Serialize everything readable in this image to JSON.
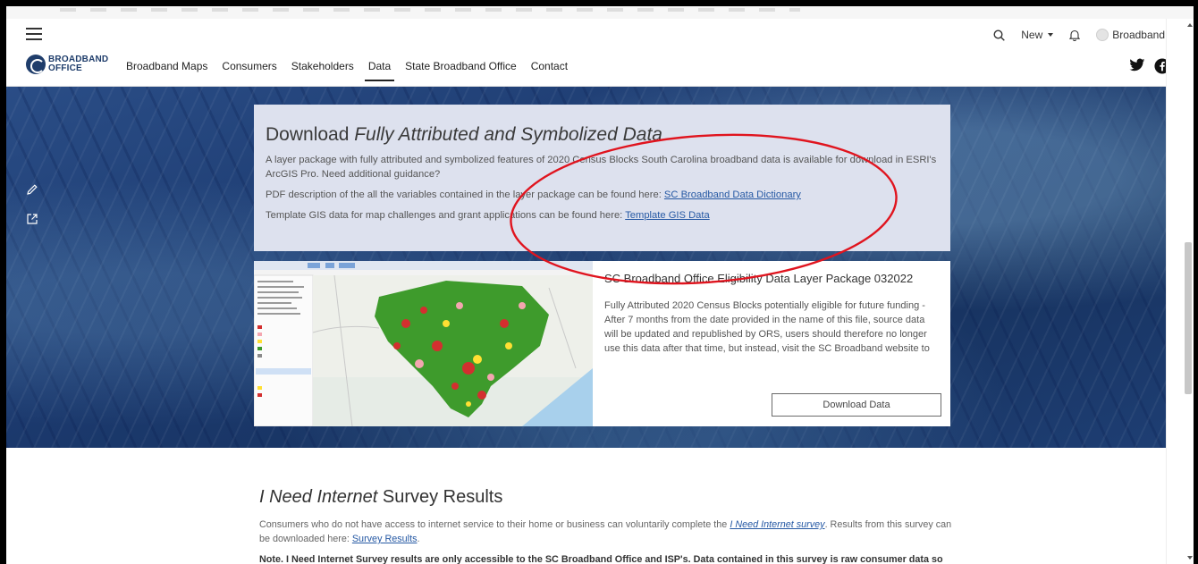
{
  "header": {
    "logo_line1": "BROADBAND",
    "logo_line2": "OFFICE",
    "nav": [
      {
        "label": "Broadband Maps"
      },
      {
        "label": "Consumers"
      },
      {
        "label": "Stakeholders"
      },
      {
        "label": "Data",
        "active": true
      },
      {
        "label": "State Broadband Office"
      },
      {
        "label": "Contact"
      }
    ],
    "util": {
      "new_label": "New",
      "account_label": "Broadband"
    },
    "icons": [
      "menu-icon",
      "search-icon",
      "bell-icon",
      "twitter-icon",
      "facebook-icon"
    ]
  },
  "side_tools": [
    "edit-icon",
    "share-icon"
  ],
  "info": {
    "title_plain": "Download ",
    "title_em": "Fully Attributed and Symbolized Data",
    "para1": "A layer package with fully attributed and symbolized features of 2020 Census Blocks South Carolina broadband data is available for download in ESRI's ArcGIS Pro. Need additional guidance?",
    "para2_text": "PDF description of the all the variables contained in the layer package can be found here: ",
    "para2_link": "SC Broadband Data Dictionary",
    "para3_text": "Template GIS data for map challenges and grant applications can be found here: ",
    "para3_link": "Template GIS Data"
  },
  "download": {
    "title": "SC Broadband Office Eligibility Data Layer Package 032022",
    "description": "Fully Attributed 2020 Census Blocks potentially eligible for future funding - After 7 months from the date provided in the name of this file, source data will be updated and republished by ORS, users should therefore no longer use this data after that time, but instead, visit the SC Broadband website to download an new, refresh dataset. For more information on FCC data",
    "button": "Download Data"
  },
  "survey": {
    "title_em": "I Need Internet",
    "title_plain": " Survey Results",
    "para_text1": "Consumers who do not have access to internet service to their home or business can voluntarily complete the ",
    "para_link1": "I Need Internet survey",
    "para_text2": ". Results from this survey can be downloaded here: ",
    "para_link2": "Survey Results",
    "para_text3": ".",
    "note": "Note. I Need Internet Survey results are only accessible to the SC Broadband Office and ISP's. Data contained in this survey is raw consumer data so"
  },
  "colors": {
    "annotation": "#e0141e",
    "link": "#2659a4",
    "info_bg": "#dde1ee",
    "brand": "#1f3d6b"
  }
}
